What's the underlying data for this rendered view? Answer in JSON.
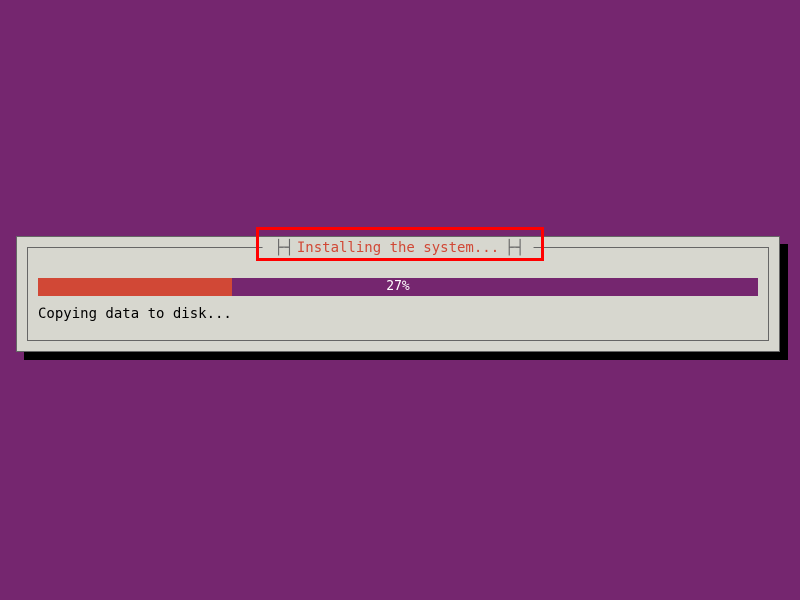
{
  "dialog": {
    "title": "Installing the system...",
    "status": "Copying data to disk..."
  },
  "progress": {
    "percent": 27,
    "percent_label": "27%"
  }
}
